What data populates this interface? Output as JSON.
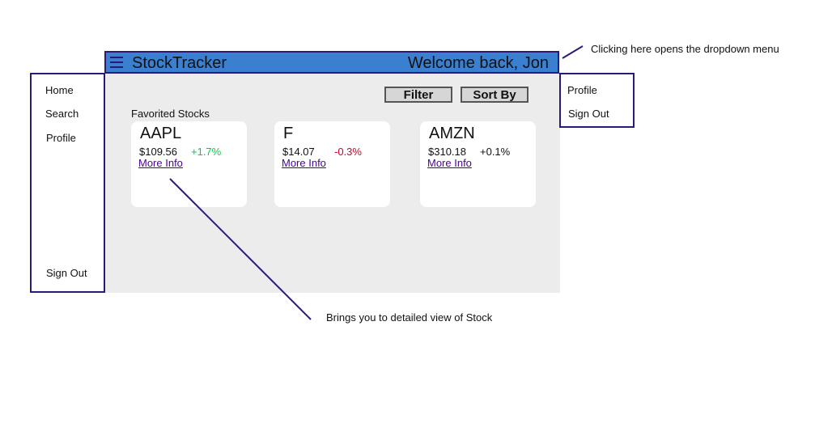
{
  "header": {
    "title": "StockTracker",
    "welcome": "Welcome back, Jon",
    "menu_icon": "hamburger-icon"
  },
  "sidebar": {
    "items": [
      {
        "label": "Home"
      },
      {
        "label": "Search"
      },
      {
        "label": "Profile"
      }
    ],
    "signout": "Sign Out"
  },
  "toolbar": {
    "filter_label": "Filter",
    "sort_label": "Sort By"
  },
  "favorites": {
    "label": "Favorited Stocks",
    "cards": [
      {
        "ticker": "AAPL",
        "price": "$109.56",
        "change": "+1.7%",
        "change_color": "#00cc44",
        "link": "More Info"
      },
      {
        "ticker": "F",
        "price": "$14.07",
        "change": "-0.3%",
        "change_color": "#d0002a",
        "link": "More Info"
      },
      {
        "ticker": "AMZN",
        "price": "$310.18",
        "change": "+0.1%",
        "change_color": "#111111",
        "link": "More Info"
      }
    ]
  },
  "dropdown": {
    "items": [
      {
        "label": "Profile"
      },
      {
        "label": "Sign Out"
      }
    ]
  },
  "annotations": {
    "dropdown_note": "Clicking here opens the dropdown menu",
    "card_note": "Brings you to detailed view of Stock"
  },
  "colors": {
    "header_bg": "#3a7fd0",
    "border": "#2a1a78",
    "content_bg": "#ececec",
    "link": "#4b0099"
  }
}
